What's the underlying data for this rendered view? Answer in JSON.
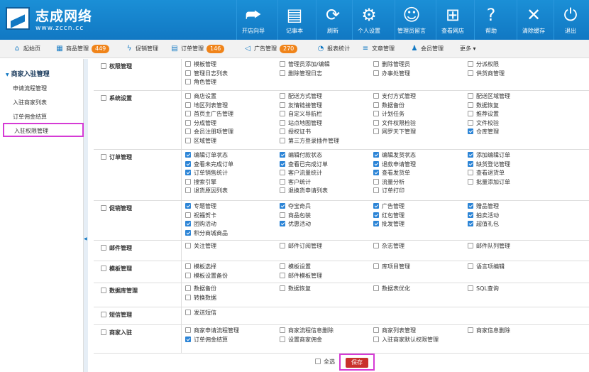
{
  "app": {
    "logo_title": "志成网络",
    "logo_url": "www.zccn.cc"
  },
  "toolbar": [
    {
      "label": "开店向导",
      "icon": "arrow-icon",
      "glyph": "⮫"
    },
    {
      "label": "记事本",
      "icon": "notepad-icon",
      "glyph": "▤"
    },
    {
      "label": "刷新",
      "icon": "refresh-icon",
      "glyph": "⟳"
    },
    {
      "label": "个人设置",
      "icon": "gear-icon",
      "glyph": "⚙"
    },
    {
      "label": "管理员留言",
      "icon": "message-icon",
      "glyph": "☺"
    },
    {
      "label": "查看网店",
      "icon": "cart-icon",
      "glyph": "⊞"
    },
    {
      "label": "帮助",
      "icon": "help-icon",
      "glyph": "?"
    },
    {
      "label": "清除缓存",
      "icon": "clear-icon",
      "glyph": "✕"
    },
    {
      "label": "退出",
      "icon": "power-icon",
      "glyph": "⏻"
    }
  ],
  "nav": [
    {
      "label": "起始页",
      "icon": "home-icon",
      "glyph": "⌂",
      "badge": ""
    },
    {
      "label": "商品管理",
      "icon": "goods-icon",
      "glyph": "▦",
      "badge": "449"
    },
    {
      "label": "促销管理",
      "icon": "promo-icon",
      "glyph": "ϟ",
      "badge": ""
    },
    {
      "label": "订单管理",
      "icon": "order-icon",
      "glyph": "▤",
      "badge": "146"
    },
    {
      "label": "广告管理",
      "icon": "ad-icon",
      "glyph": "◁",
      "badge": "270"
    },
    {
      "label": "报表统计",
      "icon": "report-icon",
      "glyph": "◔",
      "badge": ""
    },
    {
      "label": "文章管理",
      "icon": "article-icon",
      "glyph": "≡",
      "badge": ""
    },
    {
      "label": "会员管理",
      "icon": "member-icon",
      "glyph": "♟",
      "badge": ""
    },
    {
      "label": "更多",
      "icon": "more-icon",
      "glyph": "",
      "badge": ""
    }
  ],
  "sidebar": {
    "title": "商家入驻管理",
    "items": [
      "申请流程管理",
      "入驻商家列表",
      "订单佣金结算",
      "入驻权限管理"
    ],
    "active": 3
  },
  "sections": [
    {
      "title": "权限管理",
      "items": [
        [
          "模板管理",
          false
        ],
        [
          "管理员添加/编辑",
          false
        ],
        [
          "删除管理员",
          false
        ],
        [
          "分派权限",
          false
        ],
        [
          "管理日志列表",
          false
        ],
        [
          "删除管理日志",
          false
        ],
        [
          "办事处管理",
          false
        ],
        [
          "供货商管理",
          false
        ],
        [
          "角色管理",
          false
        ]
      ]
    },
    {
      "title": "系统设置",
      "items": [
        [
          "商店设置",
          false
        ],
        [
          "配送方式管理",
          false
        ],
        [
          "支付方式管理",
          false
        ],
        [
          "配送区域管理",
          false
        ],
        [
          "地区列表管理",
          false
        ],
        [
          "友情链接管理",
          false
        ],
        [
          "数据备份",
          false
        ],
        [
          "数据恢复",
          false
        ],
        [
          "首页主广告管理",
          false
        ],
        [
          "自定义导航栏",
          false
        ],
        [
          "计划任务",
          false
        ],
        [
          "推荐设置",
          false
        ],
        [
          "分成管理",
          false
        ],
        [
          "站点地图管理",
          false
        ],
        [
          "文件权限检验",
          false
        ],
        [
          "文件校验",
          false
        ],
        [
          "会员注册项管理",
          false
        ],
        [
          "授权证书",
          false
        ],
        [
          "网罗天下管理",
          false
        ],
        [
          "仓库管理",
          true
        ],
        [
          "区域管理",
          false
        ],
        [
          "第三方登录插件管理",
          false
        ]
      ]
    },
    {
      "title": "订单管理",
      "items": [
        [
          "编辑订单状态",
          true
        ],
        [
          "编辑付款状态",
          true
        ],
        [
          "编辑发货状态",
          true
        ],
        [
          "添加编辑订单",
          true
        ],
        [
          "查看未完成订单",
          true
        ],
        [
          "查看已完成订单",
          true
        ],
        [
          "退款申请管理",
          true
        ],
        [
          "缺货登记管理",
          true
        ],
        [
          "订单销售统计",
          true
        ],
        [
          "客户流量统计",
          false
        ],
        [
          "查看发货单",
          true
        ],
        [
          "查看退货单",
          false
        ],
        [
          "搜索引擎",
          false
        ],
        [
          "客户统计",
          false
        ],
        [
          "流量分析",
          false
        ],
        [
          "批量添加订单",
          false
        ],
        [
          "退货原因列表",
          false
        ],
        [
          "退换货申请列表",
          false
        ],
        [
          "订单打印",
          false
        ]
      ]
    },
    {
      "title": "促销管理",
      "items": [
        [
          "专题管理",
          true
        ],
        [
          "夺宝奇兵",
          true
        ],
        [
          "广告管理",
          true
        ],
        [
          "赠品管理",
          true
        ],
        [
          "祝福贺卡",
          false
        ],
        [
          "商品包装",
          false
        ],
        [
          "红包管理",
          true
        ],
        [
          "拍卖活动",
          true
        ],
        [
          "团购活动",
          true
        ],
        [
          "优惠活动",
          true
        ],
        [
          "批发管理",
          true
        ],
        [
          "超值礼包",
          true
        ],
        [
          "积分商城商品",
          true
        ]
      ]
    },
    {
      "title": "邮件管理",
      "items": [
        [
          "关注管理",
          false
        ],
        [
          "邮件订阅管理",
          false
        ],
        [
          "杂志管理",
          false
        ],
        [
          "邮件队列管理",
          false
        ]
      ]
    },
    {
      "title": "模板管理",
      "items": [
        [
          "模板选择",
          false
        ],
        [
          "模板设置",
          false
        ],
        [
          "库项目管理",
          false
        ],
        [
          "语言项编辑",
          false
        ],
        [
          "模板设置备份",
          false
        ],
        [
          "邮件模板管理",
          false
        ]
      ]
    },
    {
      "title": "数据库管理",
      "items": [
        [
          "数据备份",
          false
        ],
        [
          "数据恢复",
          false
        ],
        [
          "数据表优化",
          false
        ],
        [
          "SQL查询",
          false
        ],
        [
          "转换数据",
          false
        ]
      ]
    },
    {
      "title": "短信管理",
      "items": [
        [
          "发送短信",
          false
        ]
      ]
    },
    {
      "title": "商家入驻",
      "items": [
        [
          "商家申请流程管理",
          false
        ],
        [
          "商家流程信息删除",
          false
        ],
        [
          "商家列表管理",
          false
        ],
        [
          "商家信息删除",
          false
        ],
        [
          "订单佣金结算",
          true
        ],
        [
          "设置商家佣金",
          false
        ],
        [
          "入驻商家默认权限管理",
          false
        ]
      ]
    }
  ],
  "footer": {
    "select_all": "全选",
    "save": "保存"
  }
}
